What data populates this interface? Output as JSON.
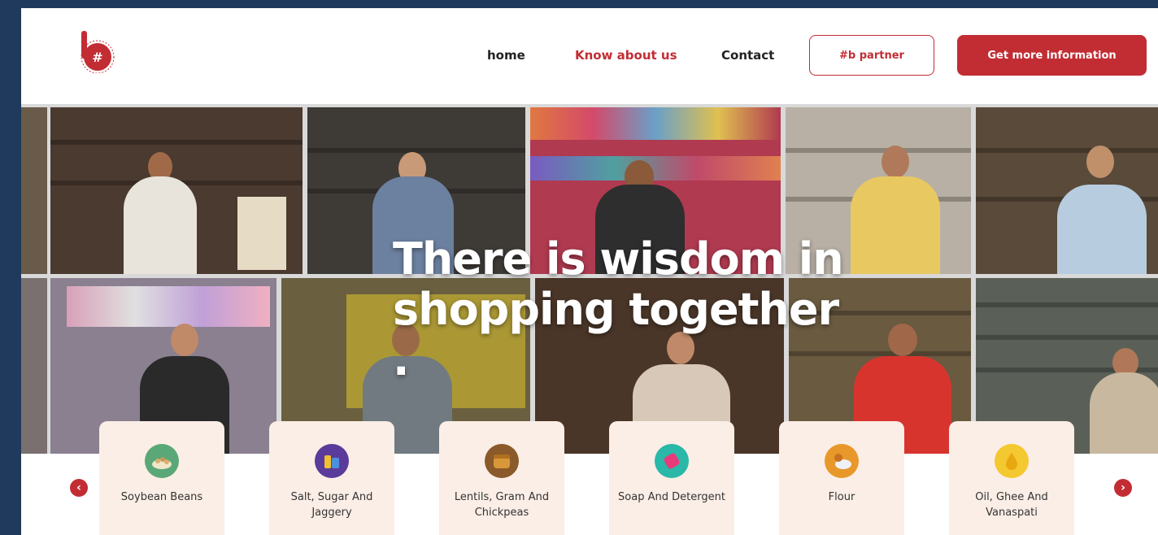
{
  "nav": {
    "logo_alt": "#b",
    "links": [
      {
        "label": "home",
        "active": false
      },
      {
        "label": "Know about us",
        "active": true
      },
      {
        "label": "Contact",
        "active": false
      }
    ],
    "partner_button": "#b partner",
    "info_button": "Get more information"
  },
  "hero": {
    "title_line1": "There is wisdom in",
    "title_line2": "shopping together ."
  },
  "categories": [
    {
      "label": "Soybean Beans",
      "icon": "soybean-icon"
    },
    {
      "label": "Salt, Sugar And Jaggery",
      "icon": "salt-sugar-icon"
    },
    {
      "label": "Lentils, Gram And Chickpeas",
      "icon": "lentils-icon"
    },
    {
      "label": "Soap And Detergent",
      "icon": "soap-icon"
    },
    {
      "label": "Flour",
      "icon": "flour-icon"
    },
    {
      "label": "Oil, Ghee And Vanaspati",
      "icon": "oil-icon"
    }
  ],
  "carousel": {
    "prev_icon": "chevron-left-icon",
    "next_icon": "chevron-right-icon"
  },
  "colors": {
    "brand": "#c22d34",
    "frame": "#1f3a5c",
    "card": "#fbeee6"
  }
}
